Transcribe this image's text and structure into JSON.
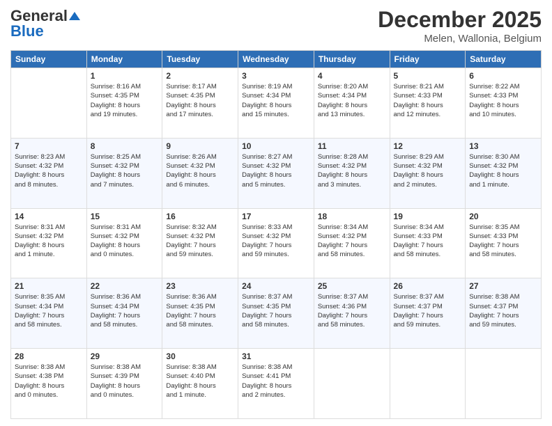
{
  "header": {
    "logo_general": "General",
    "logo_blue": "Blue",
    "month_title": "December 2025",
    "subtitle": "Melen, Wallonia, Belgium"
  },
  "days_of_week": [
    "Sunday",
    "Monday",
    "Tuesday",
    "Wednesday",
    "Thursday",
    "Friday",
    "Saturday"
  ],
  "weeks": [
    [
      {
        "day": "",
        "info": ""
      },
      {
        "day": "1",
        "info": "Sunrise: 8:16 AM\nSunset: 4:35 PM\nDaylight: 8 hours\nand 19 minutes."
      },
      {
        "day": "2",
        "info": "Sunrise: 8:17 AM\nSunset: 4:35 PM\nDaylight: 8 hours\nand 17 minutes."
      },
      {
        "day": "3",
        "info": "Sunrise: 8:19 AM\nSunset: 4:34 PM\nDaylight: 8 hours\nand 15 minutes."
      },
      {
        "day": "4",
        "info": "Sunrise: 8:20 AM\nSunset: 4:34 PM\nDaylight: 8 hours\nand 13 minutes."
      },
      {
        "day": "5",
        "info": "Sunrise: 8:21 AM\nSunset: 4:33 PM\nDaylight: 8 hours\nand 12 minutes."
      },
      {
        "day": "6",
        "info": "Sunrise: 8:22 AM\nSunset: 4:33 PM\nDaylight: 8 hours\nand 10 minutes."
      }
    ],
    [
      {
        "day": "7",
        "info": "Sunrise: 8:23 AM\nSunset: 4:32 PM\nDaylight: 8 hours\nand 8 minutes."
      },
      {
        "day": "8",
        "info": "Sunrise: 8:25 AM\nSunset: 4:32 PM\nDaylight: 8 hours\nand 7 minutes."
      },
      {
        "day": "9",
        "info": "Sunrise: 8:26 AM\nSunset: 4:32 PM\nDaylight: 8 hours\nand 6 minutes."
      },
      {
        "day": "10",
        "info": "Sunrise: 8:27 AM\nSunset: 4:32 PM\nDaylight: 8 hours\nand 5 minutes."
      },
      {
        "day": "11",
        "info": "Sunrise: 8:28 AM\nSunset: 4:32 PM\nDaylight: 8 hours\nand 3 minutes."
      },
      {
        "day": "12",
        "info": "Sunrise: 8:29 AM\nSunset: 4:32 PM\nDaylight: 8 hours\nand 2 minutes."
      },
      {
        "day": "13",
        "info": "Sunrise: 8:30 AM\nSunset: 4:32 PM\nDaylight: 8 hours\nand 1 minute."
      }
    ],
    [
      {
        "day": "14",
        "info": "Sunrise: 8:31 AM\nSunset: 4:32 PM\nDaylight: 8 hours\nand 1 minute."
      },
      {
        "day": "15",
        "info": "Sunrise: 8:31 AM\nSunset: 4:32 PM\nDaylight: 8 hours\nand 0 minutes."
      },
      {
        "day": "16",
        "info": "Sunrise: 8:32 AM\nSunset: 4:32 PM\nDaylight: 7 hours\nand 59 minutes."
      },
      {
        "day": "17",
        "info": "Sunrise: 8:33 AM\nSunset: 4:32 PM\nDaylight: 7 hours\nand 59 minutes."
      },
      {
        "day": "18",
        "info": "Sunrise: 8:34 AM\nSunset: 4:32 PM\nDaylight: 7 hours\nand 58 minutes."
      },
      {
        "day": "19",
        "info": "Sunrise: 8:34 AM\nSunset: 4:33 PM\nDaylight: 7 hours\nand 58 minutes."
      },
      {
        "day": "20",
        "info": "Sunrise: 8:35 AM\nSunset: 4:33 PM\nDaylight: 7 hours\nand 58 minutes."
      }
    ],
    [
      {
        "day": "21",
        "info": "Sunrise: 8:35 AM\nSunset: 4:34 PM\nDaylight: 7 hours\nand 58 minutes."
      },
      {
        "day": "22",
        "info": "Sunrise: 8:36 AM\nSunset: 4:34 PM\nDaylight: 7 hours\nand 58 minutes."
      },
      {
        "day": "23",
        "info": "Sunrise: 8:36 AM\nSunset: 4:35 PM\nDaylight: 7 hours\nand 58 minutes."
      },
      {
        "day": "24",
        "info": "Sunrise: 8:37 AM\nSunset: 4:35 PM\nDaylight: 7 hours\nand 58 minutes."
      },
      {
        "day": "25",
        "info": "Sunrise: 8:37 AM\nSunset: 4:36 PM\nDaylight: 7 hours\nand 58 minutes."
      },
      {
        "day": "26",
        "info": "Sunrise: 8:37 AM\nSunset: 4:37 PM\nDaylight: 7 hours\nand 59 minutes."
      },
      {
        "day": "27",
        "info": "Sunrise: 8:38 AM\nSunset: 4:37 PM\nDaylight: 7 hours\nand 59 minutes."
      }
    ],
    [
      {
        "day": "28",
        "info": "Sunrise: 8:38 AM\nSunset: 4:38 PM\nDaylight: 8 hours\nand 0 minutes."
      },
      {
        "day": "29",
        "info": "Sunrise: 8:38 AM\nSunset: 4:39 PM\nDaylight: 8 hours\nand 0 minutes."
      },
      {
        "day": "30",
        "info": "Sunrise: 8:38 AM\nSunset: 4:40 PM\nDaylight: 8 hours\nand 1 minute."
      },
      {
        "day": "31",
        "info": "Sunrise: 8:38 AM\nSunset: 4:41 PM\nDaylight: 8 hours\nand 2 minutes."
      },
      {
        "day": "",
        "info": ""
      },
      {
        "day": "",
        "info": ""
      },
      {
        "day": "",
        "info": ""
      }
    ]
  ]
}
